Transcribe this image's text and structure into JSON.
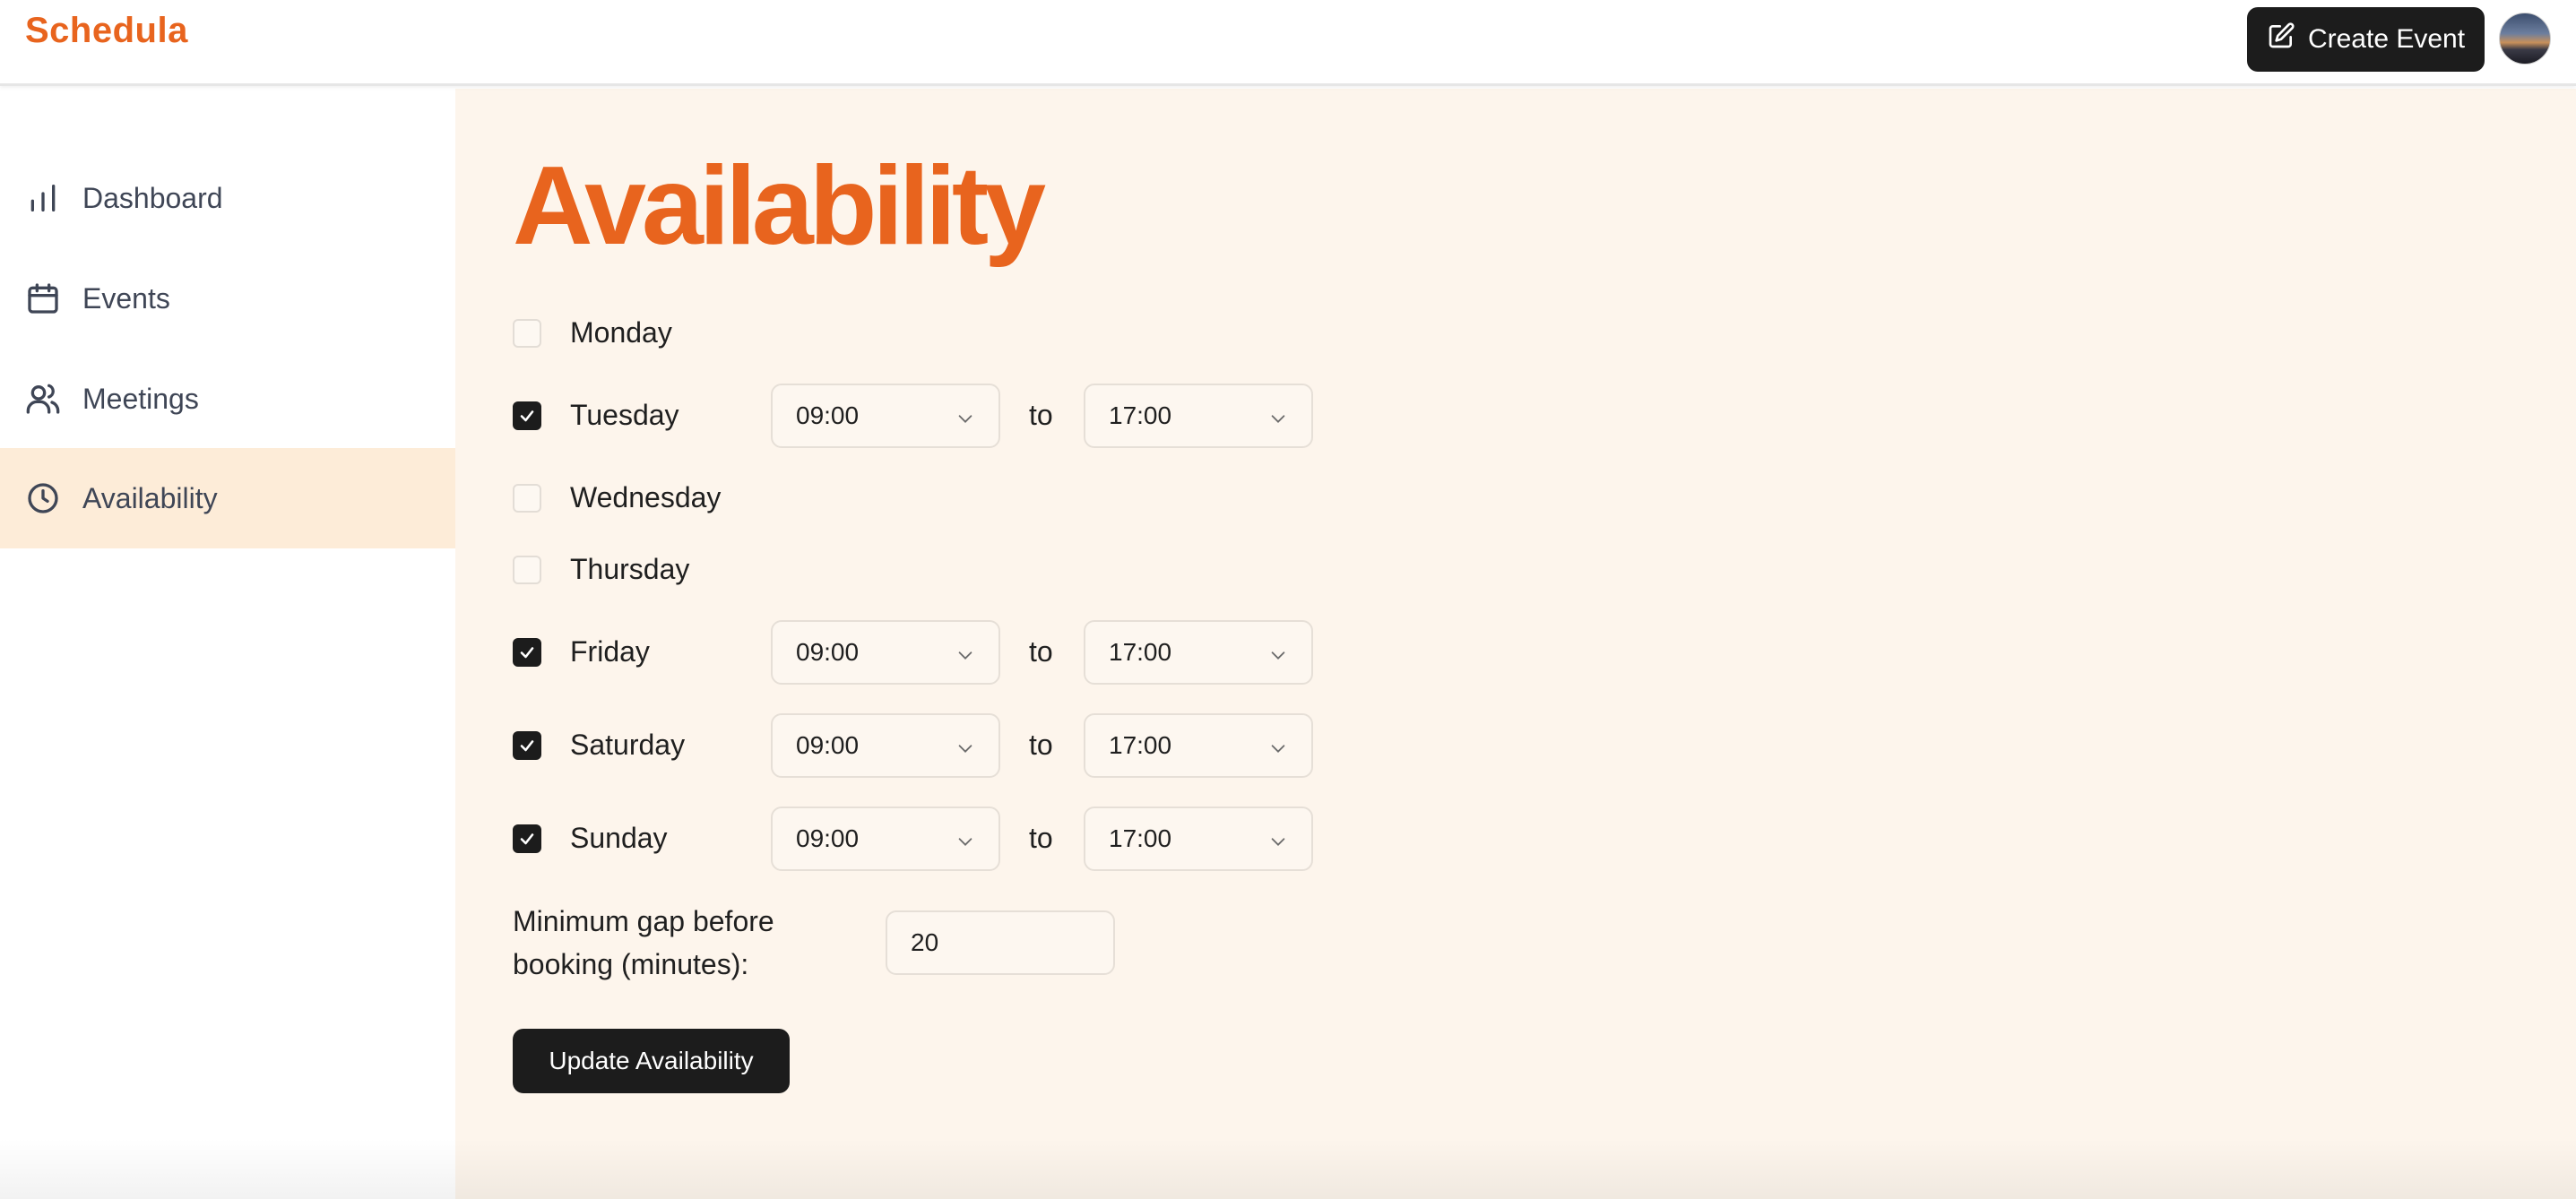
{
  "app": {
    "name": "Schedula"
  },
  "header": {
    "create_label": "Create Event"
  },
  "sidebar": {
    "items": [
      {
        "label": "Dashboard",
        "icon": "bar-chart-icon",
        "active": false
      },
      {
        "label": "Events",
        "icon": "calendar-icon",
        "active": false
      },
      {
        "label": "Meetings",
        "icon": "users-icon",
        "active": false
      },
      {
        "label": "Availability",
        "icon": "clock-icon",
        "active": true
      }
    ]
  },
  "main": {
    "title": "Availability",
    "to_label": "to",
    "days": [
      {
        "name": "Monday",
        "checked": false
      },
      {
        "name": "Tuesday",
        "checked": true,
        "start": "09:00",
        "end": "17:00"
      },
      {
        "name": "Wednesday",
        "checked": false
      },
      {
        "name": "Thursday",
        "checked": false
      },
      {
        "name": "Friday",
        "checked": true,
        "start": "09:00",
        "end": "17:00"
      },
      {
        "name": "Saturday",
        "checked": true,
        "start": "09:00",
        "end": "17:00"
      },
      {
        "name": "Sunday",
        "checked": true,
        "start": "09:00",
        "end": "17:00"
      }
    ],
    "gap": {
      "label": "Minimum gap before booking (minutes):",
      "value": "20"
    },
    "submit_label": "Update Availability"
  },
  "colors": {
    "accent": "#e8641e",
    "dark": "#1c1c1c",
    "main_bg": "#fdf5ec",
    "active_bg": "#fdecd8"
  }
}
